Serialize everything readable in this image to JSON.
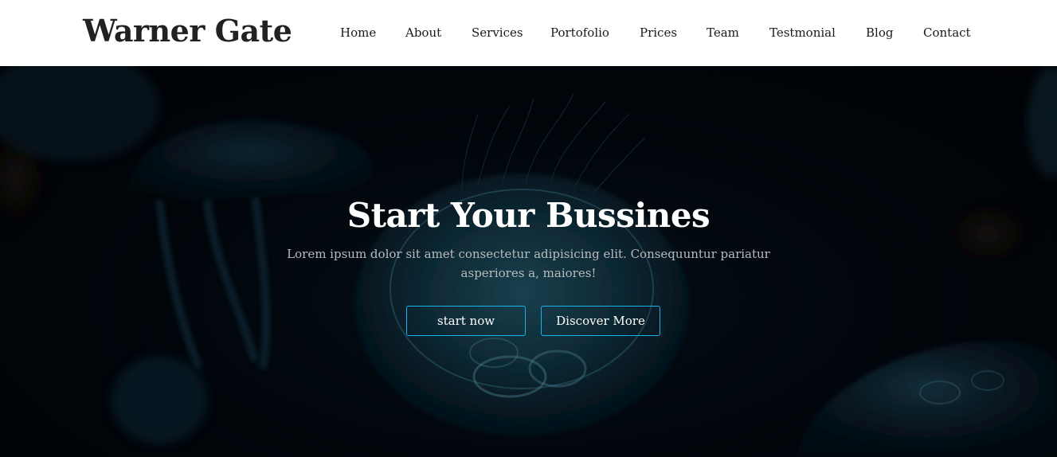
{
  "brand": {
    "name": "Warner Gate"
  },
  "nav": {
    "items": [
      {
        "label": "Home"
      },
      {
        "label": "About"
      },
      {
        "label": "Services"
      },
      {
        "label": "Portofolio"
      },
      {
        "label": "Prices"
      },
      {
        "label": "Team"
      },
      {
        "label": "Testmonial"
      },
      {
        "label": "Blog"
      },
      {
        "label": "Contact"
      }
    ]
  },
  "hero": {
    "title": "Start Your Bussines",
    "subtitle": "Lorem ipsum dolor sit amet consectetur adipisicing elit. Consequuntur pariatur asperiores a, maiores!",
    "primary_button": "start now",
    "secondary_button": "Discover More",
    "background_image": "jellyfish-underwater-photo"
  },
  "colors": {
    "accent": "#19b4ec",
    "nav_bg": "#ffffff",
    "hero_overlay": "#02060c",
    "brand_text": "#222222"
  }
}
